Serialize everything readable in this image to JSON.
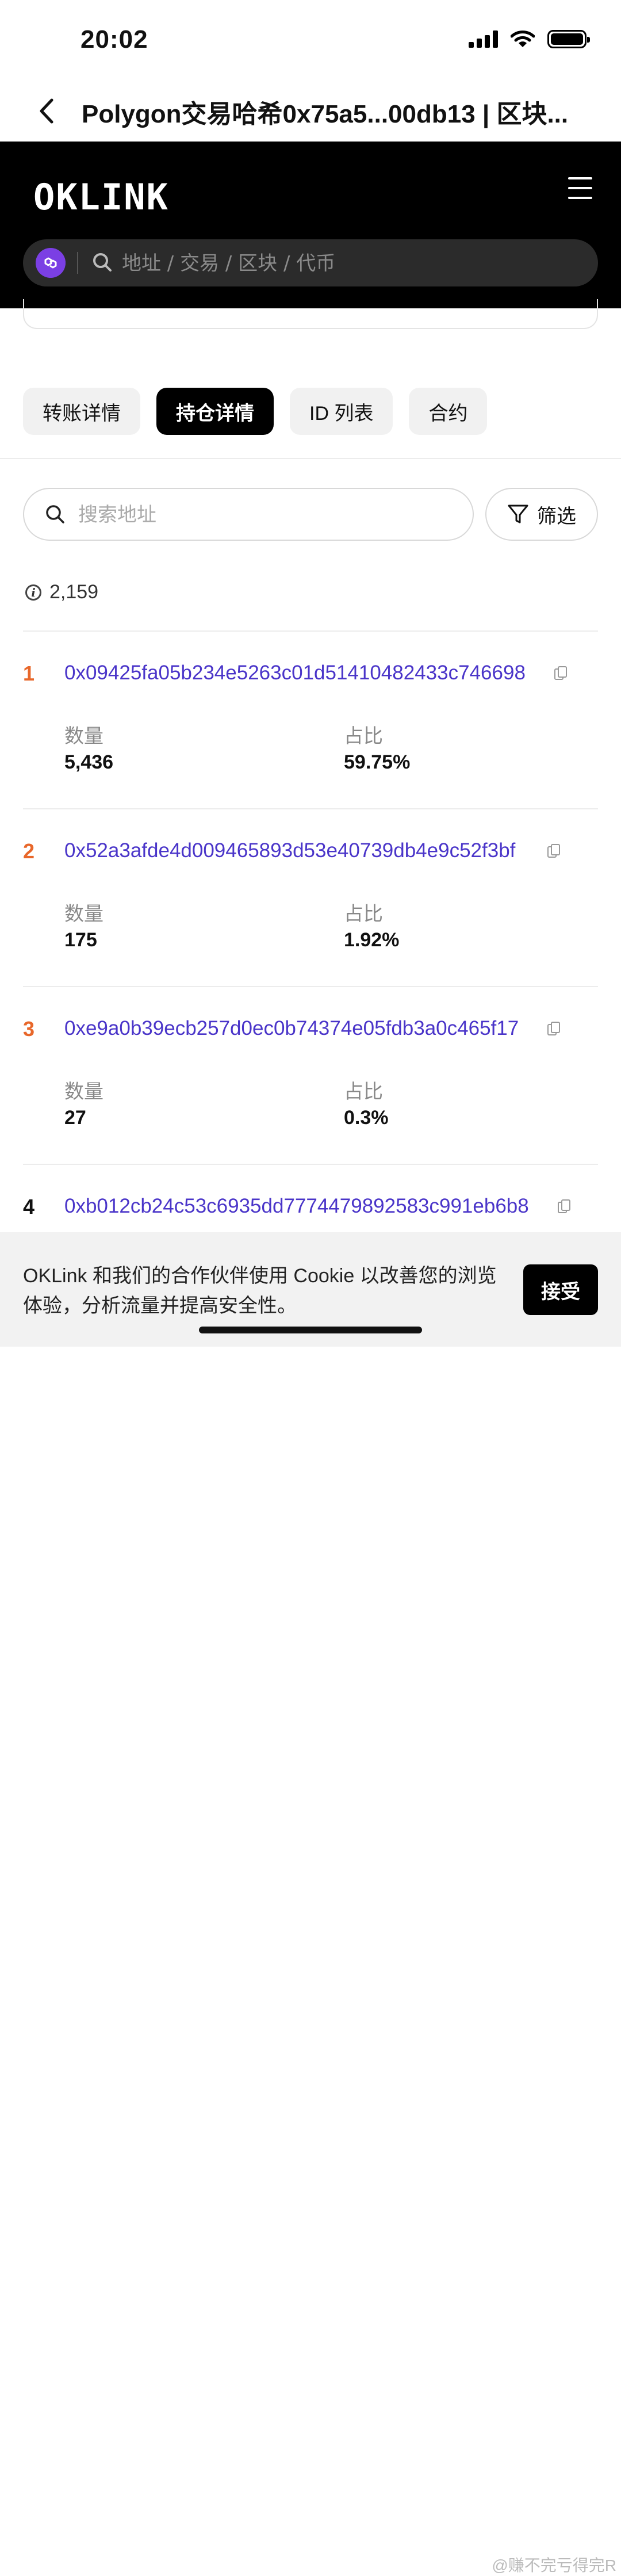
{
  "status_bar": {
    "time": "20:02"
  },
  "browser": {
    "title": "Polygon交易哈希0x75a5...00db13 | 区块..."
  },
  "site": {
    "logo": "OKLINK",
    "search_placeholder": "地址 / 交易 / 区块 / 代币"
  },
  "tabs": [
    {
      "label": "转账详情",
      "active": false
    },
    {
      "label": "持仓详情",
      "active": true
    },
    {
      "label": "ID 列表",
      "active": false
    },
    {
      "label": "合约",
      "active": false
    }
  ],
  "address_search": {
    "placeholder": "搜索地址"
  },
  "filter": {
    "label": "筛选"
  },
  "total_count": "2,159",
  "holders": [
    {
      "rank": "1",
      "address": "0x09425fa05b234e5263c01d51410482433c746698",
      "quantity_label": "数量",
      "quantity": "5,436",
      "ratio_label": "占比",
      "ratio": "59.75%"
    },
    {
      "rank": "2",
      "address": "0x52a3afde4d009465893d53e40739db4e9c52f3bf",
      "quantity_label": "数量",
      "quantity": "175",
      "ratio_label": "占比",
      "ratio": "1.92%"
    },
    {
      "rank": "3",
      "address": "0xe9a0b39ecb257d0ec0b74374e05fdb3a0c465f17",
      "quantity_label": "数量",
      "quantity": "27",
      "ratio_label": "占比",
      "ratio": "0.3%"
    },
    {
      "rank": "4",
      "address": "0xb012cb24c53c6935dd7774479892583c991eb6b8"
    }
  ],
  "cookie": {
    "text": "OKLink 和我们的合作伙伴使用 Cookie 以改善您的浏览体验，分析流量并提高安全性。",
    "accept_label": "接受"
  },
  "watermark": "@赚不完亏得完R",
  "colors": {
    "accent": "#4a35c9",
    "rank_highlight": "#e8672a",
    "chain": "#7b3fe4"
  }
}
